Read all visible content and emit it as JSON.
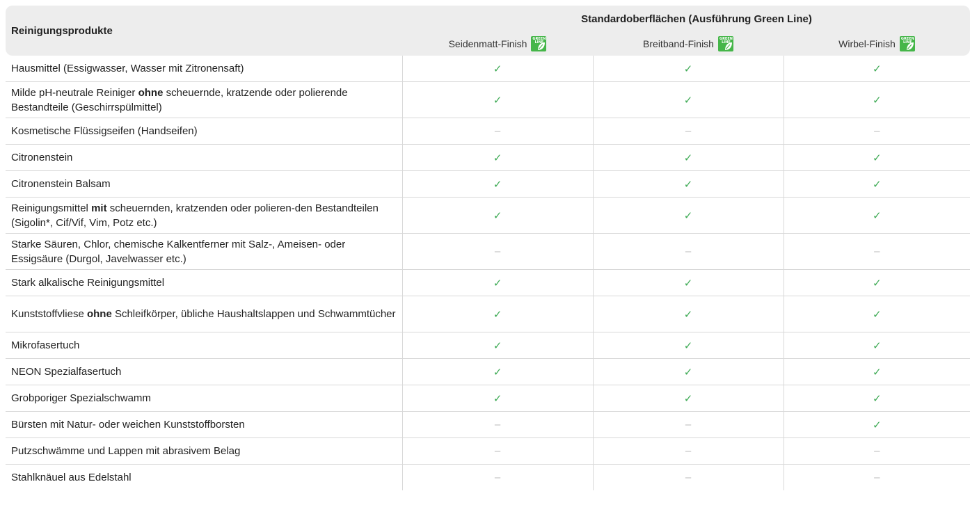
{
  "header": {
    "product_column": "Reinigungsprodukte",
    "group_title": "Standardoberflächen (Ausführung Green Line)",
    "columns": [
      "Seidenmatt-Finish",
      "Breitband-Finish",
      "Wirbel-Finish"
    ],
    "badge": "green-line-icon",
    "badge_text_line1": "GREEN",
    "badge_text_line2": "LINE"
  },
  "symbols": {
    "suitable": "✓",
    "not_suitable": "–"
  },
  "colors": {
    "check": "#3daa54",
    "dash": "#b8b8b8",
    "badge": "#45b649",
    "header_bg": "#ededed"
  },
  "rows": [
    {
      "pre": "Hausmittel (Essigwasser, Wasser mit Zitronensaft)",
      "bold": "",
      "post": "",
      "values": [
        "✓",
        "✓",
        "✓"
      ]
    },
    {
      "pre": "Milde pH-neutrale Reiniger ",
      "bold": "ohne",
      "post": " scheuernde, kratzende oder polierende Bestandteile (Geschirrspülmittel)",
      "values": [
        "✓",
        "✓",
        "✓"
      ]
    },
    {
      "pre": "Kosmetische Flüssigseifen (Handseifen)",
      "bold": "",
      "post": "",
      "values": [
        "–",
        "–",
        "–"
      ]
    },
    {
      "pre": "Citronenstein",
      "bold": "",
      "post": "",
      "values": [
        "✓",
        "✓",
        "✓"
      ]
    },
    {
      "pre": "Citronenstein Balsam",
      "bold": "",
      "post": "",
      "values": [
        "✓",
        "✓",
        "✓"
      ]
    },
    {
      "pre": "Reinigungsmittel ",
      "bold": "mit",
      "post": " scheuernden, kratzenden oder polieren-den Bestandteilen (Sigolin*, Cif/Vif, Vim, Potz etc.)",
      "values": [
        "✓",
        "✓",
        "✓"
      ]
    },
    {
      "pre": "Starke Säuren, Chlor, chemische Kalkentferner mit Salz-, Ameisen- oder Essigsäure (Durgol, Javelwasser etc.)",
      "bold": "",
      "post": "",
      "values": [
        "–",
        "–",
        "–"
      ]
    },
    {
      "pre": "Stark alkalische Reinigungsmittel",
      "bold": "",
      "post": "",
      "values": [
        "✓",
        "✓",
        "✓"
      ]
    },
    {
      "pre": "Kunststoffvliese ",
      "bold": "ohne",
      "post": " Schleifkörper, übliche Haushaltslappen und Schwammtücher",
      "values": [
        "✓",
        "✓",
        "✓"
      ]
    },
    {
      "pre": "Mikrofasertuch",
      "bold": "",
      "post": "",
      "values": [
        "✓",
        "✓",
        "✓"
      ]
    },
    {
      "pre": "NEON Spezialfasertuch",
      "bold": "",
      "post": "",
      "values": [
        "✓",
        "✓",
        "✓"
      ]
    },
    {
      "pre": "Grobporiger Spezialschwamm",
      "bold": "",
      "post": "",
      "values": [
        "✓",
        "✓",
        "✓"
      ]
    },
    {
      "pre": "Bürsten mit Natur- oder weichen Kunststoffborsten",
      "bold": "",
      "post": "",
      "values": [
        "–",
        "–",
        "✓"
      ]
    },
    {
      "pre": "Putzschwämme und Lappen mit abrasivem Belag",
      "bold": "",
      "post": "",
      "values": [
        "–",
        "–",
        "–"
      ]
    },
    {
      "pre": "Stahlknäuel aus Edelstahl",
      "bold": "",
      "post": "",
      "values": [
        "–",
        "–",
        "–"
      ]
    }
  ]
}
